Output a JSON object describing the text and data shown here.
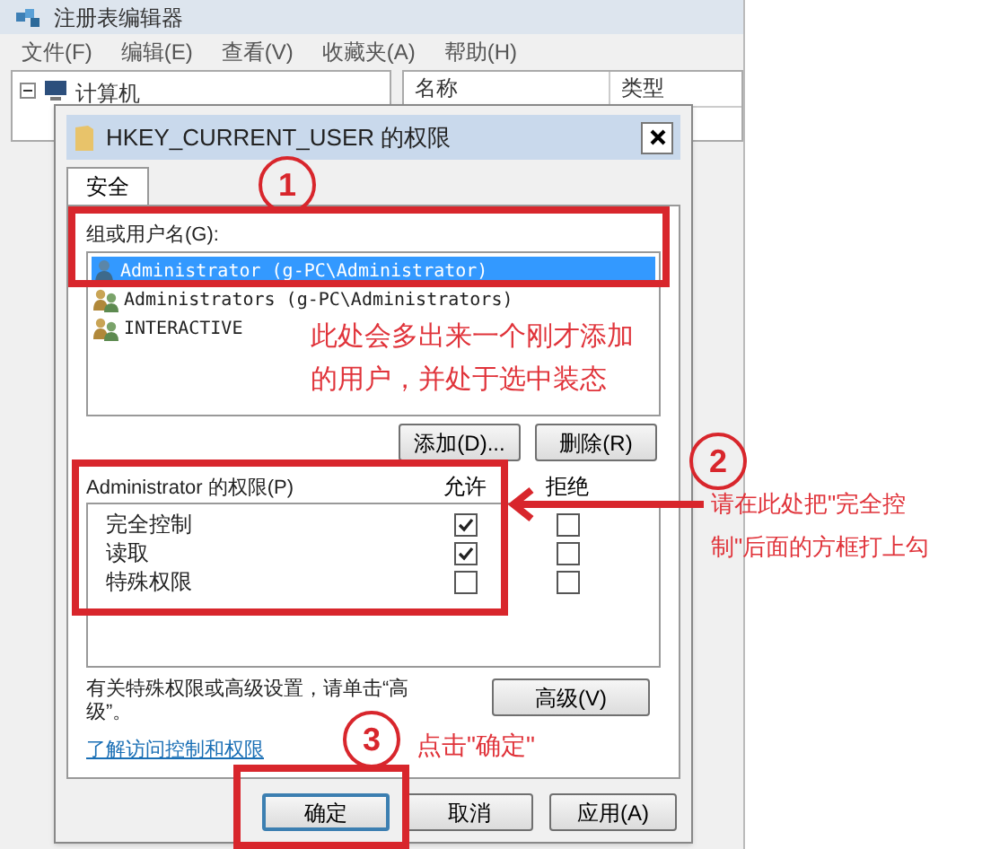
{
  "registry_window": {
    "title": "注册表编辑器",
    "menu": [
      "文件(F)",
      "编辑(E)",
      "查看(V)",
      "收藏夹(A)",
      "帮助(H)"
    ],
    "tree": {
      "label": "计算机",
      "expanded": true
    },
    "columns": [
      "名称",
      "类型"
    ]
  },
  "dialog": {
    "title": "HKEY_CURRENT_USER 的权限",
    "tabs": [
      {
        "label": "安全",
        "selected": true
      }
    ],
    "group_label": "组或用户名(G):",
    "users": [
      {
        "name": "Administrator (g-PC\\Administrator)",
        "selected": true,
        "kind": "user"
      },
      {
        "name": "Administrators (g-PC\\Administrators)",
        "selected": false,
        "kind": "group"
      },
      {
        "name": "INTERACTIVE",
        "selected": false,
        "kind": "group"
      }
    ],
    "user_buttons": [
      "添加(D)...",
      "删除(R)"
    ],
    "permissions_label": "Administrator 的权限(P)",
    "allow_header": "允许",
    "deny_header": "拒绝",
    "permissions": [
      {
        "name": "完全控制",
        "allow": true,
        "deny": false
      },
      {
        "name": "读取",
        "allow": true,
        "deny": false
      },
      {
        "name": "特殊权限",
        "allow": false,
        "deny": false
      }
    ],
    "info_text": "有关特殊权限或高级设置，请单击“高级”。",
    "advanced_button": "高级(V)",
    "link": "了解访问控制和权限",
    "footer_buttons": [
      {
        "label": "确定",
        "default": true
      },
      {
        "label": "取消",
        "default": false
      },
      {
        "label": "应用(A)",
        "default": false
      }
    ]
  },
  "annotations": {
    "markers": [
      "1",
      "2",
      "3"
    ],
    "note_users": [
      "此处会多出来一个刚才添加",
      "的用户，并处于选中装态"
    ],
    "note_permissions": [
      "请在此处把\"完全控",
      "制\"后面的方框打上勾"
    ],
    "note_ok": "点击\"确定\""
  }
}
